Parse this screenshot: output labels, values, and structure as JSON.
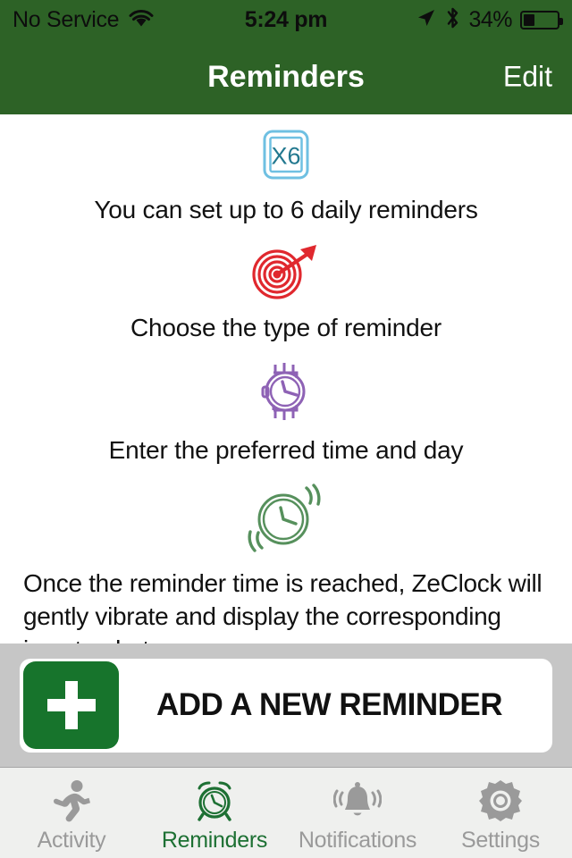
{
  "status_bar": {
    "carrier": "No Service",
    "wifi_icon": "wifi-icon",
    "time": "5:24 pm",
    "location_icon": "location-arrow-icon",
    "bluetooth_icon": "bluetooth-icon",
    "battery_percent": "34%",
    "battery_level": 34,
    "battery_icon": "battery-icon"
  },
  "nav_bar": {
    "title": "Reminders",
    "edit_label": "Edit",
    "background_color": "#2d6226"
  },
  "content": {
    "steps": [
      {
        "icon_name": "x6-badge-icon",
        "icon_color": "#2f8fab",
        "text": "You can set up to 6 daily reminders",
        "badge_text": "X6"
      },
      {
        "icon_name": "target-bullseye-icon",
        "icon_color": "#e0282e",
        "text": "Choose the type of reminder"
      },
      {
        "icon_name": "wristwatch-icon",
        "icon_color": "#8e62b5",
        "text": "Enter the preferred time and day"
      },
      {
        "icon_name": "vibrating-clock-icon",
        "icon_color": "#56905c",
        "text": ""
      }
    ],
    "final_note": "Once the reminder time is reached, ZeClock will gently vibrate and display the corresponding icon to alert you."
  },
  "add_panel": {
    "button_label": "ADD A NEW REMINDER",
    "plus_icon": "plus-icon",
    "plus_box_color": "#17742c",
    "panel_color": "#c6c6c6"
  },
  "tab_bar": {
    "active_color": "#1d7033",
    "inactive_color": "#9a9a9a",
    "tabs": [
      {
        "label": "Activity",
        "icon_name": "running-person-icon",
        "active": false
      },
      {
        "label": "Reminders",
        "icon_name": "alarm-clock-icon",
        "active": true
      },
      {
        "label": "Notifications",
        "icon_name": "bell-icon",
        "active": false
      },
      {
        "label": "Settings",
        "icon_name": "gear-icon",
        "active": false
      }
    ]
  }
}
